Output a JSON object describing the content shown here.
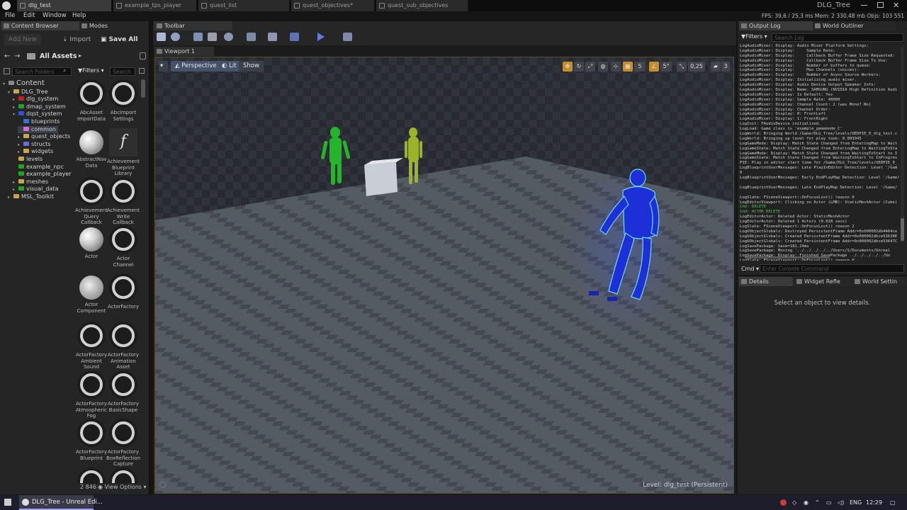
{
  "window": {
    "title": "DLG_Tree",
    "tabs": [
      {
        "label": "dlg_test",
        "active": true
      },
      {
        "label": "example_tps_player",
        "active": false
      },
      {
        "label": "quest_list",
        "active": false
      },
      {
        "label": "quest_objectives*",
        "active": false
      },
      {
        "label": "quest_sub_objectives",
        "active": false
      }
    ],
    "menu": [
      "File",
      "Edit",
      "Window",
      "Help"
    ],
    "stats": "FPS: 39,6 / 25,3 ms  Mem: 2 330,48 mb  Objs: 103 551"
  },
  "content_browser": {
    "tabs": [
      "Content Browser",
      "Modes"
    ],
    "add_new": "Add New",
    "import": "Import",
    "save_all": "Save All",
    "breadcrumb": "All Assets",
    "search_folders_placeholder": "Search Folders",
    "filters_label": "Filters",
    "search_assets_placeholder": "Search",
    "tree": [
      {
        "label": "Content",
        "depth": 0,
        "color": "#8a8a8a",
        "arrow": "▾"
      },
      {
        "label": "DLG_Tree",
        "depth": 1,
        "color": "#c9a64b",
        "arrow": "▾"
      },
      {
        "label": "dlg_system",
        "depth": 2,
        "color": "#c02020",
        "arrow": "▸"
      },
      {
        "label": "dmap_system",
        "depth": 2,
        "color": "#1fa32a",
        "arrow": "▸"
      },
      {
        "label": "dqst_system",
        "depth": 2,
        "color": "#3350d6",
        "arrow": "▾"
      },
      {
        "label": "blueprints",
        "depth": 3,
        "color": "#3a6fe0",
        "arrow": ""
      },
      {
        "label": "common",
        "depth": 3,
        "color": "#d66dd6",
        "arrow": "",
        "selected": true
      },
      {
        "label": "quest_objects",
        "depth": 3,
        "color": "#c9a64b",
        "arrow": "▸"
      },
      {
        "label": "structs",
        "depth": 3,
        "color": "#6a6de0",
        "arrow": "▸"
      },
      {
        "label": "widgets",
        "depth": 3,
        "color": "#c9a64b",
        "arrow": "▸"
      },
      {
        "label": "levels",
        "depth": 2,
        "color": "#c9a64b",
        "arrow": ""
      },
      {
        "label": "example_npc",
        "depth": 2,
        "color": "#1fa32a",
        "arrow": ""
      },
      {
        "label": "example_player",
        "depth": 2,
        "color": "#1fa32a",
        "arrow": ""
      },
      {
        "label": "meshes",
        "depth": 2,
        "color": "#c9a64b",
        "arrow": "▸"
      },
      {
        "label": "visual_data",
        "depth": 2,
        "color": "#1fa32a",
        "arrow": "▸"
      },
      {
        "label": "MSL_Toolkit",
        "depth": 1,
        "color": "#c9a64b",
        "arrow": "▸"
      }
    ],
    "assets": [
      {
        "label": "AbcAsset ImportData",
        "icon": "ring"
      },
      {
        "label": "AbcImport Settings",
        "icon": "ring"
      },
      {
        "label": "AbstractNav Data",
        "icon": "sphere"
      },
      {
        "label": "Achievement Blueprint Library",
        "icon": "func"
      },
      {
        "label": "Achievement Query Callback",
        "icon": "ring"
      },
      {
        "label": "Achievement Write Callback",
        "icon": "ring"
      },
      {
        "label": "Actor",
        "icon": "sphere"
      },
      {
        "label": "Actor Channel",
        "icon": "ring"
      },
      {
        "label": "Actor Component",
        "icon": "actorcomp"
      },
      {
        "label": "ActorFactory",
        "icon": "ring"
      },
      {
        "label": "ActorFactory Ambient Sound",
        "icon": "ring"
      },
      {
        "label": "ActorFactory Animation Asset",
        "icon": "ring"
      },
      {
        "label": "ActorFactory Atmospheric Fog",
        "icon": "ring"
      },
      {
        "label": "ActorFactory BasicShape",
        "icon": "ring"
      },
      {
        "label": "ActorFactory Blueprint",
        "icon": "ring"
      },
      {
        "label": "ActorFactory BoxReflection Capture",
        "icon": "ring"
      },
      {
        "label": "",
        "icon": "ring"
      },
      {
        "label": "",
        "icon": "ring"
      }
    ],
    "item_count": "2 846",
    "view_options": "View Options"
  },
  "toolbar": {
    "panel_title": "Toolbar"
  },
  "viewport": {
    "tab": "Viewport 1",
    "perspective": "Perspective",
    "lit": "Lit",
    "show": "Show",
    "grid_snap": "5",
    "rot_snap": "5°",
    "scale_snap": "0,25",
    "cam_speed": "3",
    "level_label": "Level:",
    "level_name": "dlg_test (Persistent)"
  },
  "output_log": {
    "tabs": [
      "Output Log",
      "World Outliner"
    ],
    "filters": "Filters",
    "search_placeholder": "Search Log",
    "lines": [
      {
        "t": "LogAudioMixer: Display: Audio Mixer Platform Settings:",
        "c": ""
      },
      {
        "t": "LogAudioMixer: Display:     Sample Rate:",
        "c": ""
      },
      {
        "t": "LogAudioMixer: Display:     Callback Buffer Frame Size Requested:",
        "c": ""
      },
      {
        "t": "LogAudioMixer: Display:     Callback Buffer Frame Size To Use:",
        "c": ""
      },
      {
        "t": "LogAudioMixer: Display:     Number of buffers to queue:",
        "c": ""
      },
      {
        "t": "LogAudioMixer: Display:     Max Channels (voices):",
        "c": ""
      },
      {
        "t": "LogAudioMixer: Display:     Number of Async Source Workers:",
        "c": ""
      },
      {
        "t": "LogAudioMixer: Display: Initializing audio mixer.",
        "c": ""
      },
      {
        "t": "LogAudioMixer: Display: Audio Device Output Speaker Info:",
        "c": ""
      },
      {
        "t": "LogAudioMixer: Display: Name: SAMSUNG (NVIDIA High Definition Audi",
        "c": ""
      },
      {
        "t": "LogAudioMixer: Display: Is Default: Yes",
        "c": ""
      },
      {
        "t": "LogAudioMixer: Display: Sample Rate: 48000",
        "c": ""
      },
      {
        "t": "LogAudioMixer: Display: Channel Count: 2 (was Mono? No)",
        "c": ""
      },
      {
        "t": "LogAudioMixer: Display: Channel Order:",
        "c": ""
      },
      {
        "t": "LogAudioMixer: Display: 0: FrontLeft",
        "c": ""
      },
      {
        "t": "LogAudioMixer: Display: 1: FrontRight",
        "c": ""
      },
      {
        "t": "LogInit: FAudioDevice initialized.",
        "c": ""
      },
      {
        "t": "LogLoad: Game class is 'example_gamemode_C'",
        "c": ""
      },
      {
        "t": "LogWorld: Bringing World /Game/DLG_Tree/levels/UEDPIE_0_dlg_test.c",
        "c": ""
      },
      {
        "t": "LogWorld: Bringing up level for play took: 0.003945",
        "c": ""
      },
      {
        "t": "LogGameMode: Display: Match State Changed from EnteringMap to Wait",
        "c": ""
      },
      {
        "t": "LogGameState: Match State Changed from EnteringMap to WaitingToSta",
        "c": ""
      },
      {
        "t": "LogGameMode: Display: Match State Changed from WaitingToStart to I",
        "c": ""
      },
      {
        "t": "LogGameState: Match State Changed from WaitingToStart to InProgres",
        "c": ""
      },
      {
        "t": "PIE: Play in editor start time for /Game/DLG_Tree/levels/UEDPIE_0_",
        "c": ""
      },
      {
        "t": "LogBlueprintUserMessages: Late PlayInEditor Detection: Level '/Gam",
        "c": ""
      },
      {
        "t": "0",
        "c": ""
      },
      {
        "t": "LogBlueprintUserMessages: Early EndPlayMap Detection: Level '/Game/",
        "c": ""
      },
      {
        "t": "",
        "c": ""
      },
      {
        "t": "LogBlueprintUserMessages: Late EndPlayMap Detection: Level '/Game/",
        "c": ""
      },
      {
        "t": "",
        "c": ""
      },
      {
        "t": "LogSlate: FSceneViewport::OnFocusLost() reason 0",
        "c": ""
      },
      {
        "t": "LogEditorViewport: Clicking on Actor (LMB): StaticMeshActor (Cube)",
        "c": ""
      },
      {
        "t": "Cmd: DELETE",
        "c": "g"
      },
      {
        "t": "Cmd: ACTOR DELETE",
        "c": "g"
      },
      {
        "t": "LogEditorActor: Deleted Actor: StaticMeshActor",
        "c": ""
      },
      {
        "t": "LogEditorActor: Deleted 1 Actors (0.028 secs)",
        "c": ""
      },
      {
        "t": "LogSlate: FSceneViewport::OnFocusLost() reason 2",
        "c": ""
      },
      {
        "t": "LogUObjectGlobals: Destroyed PersistentFrame Addr=0x000002db4464ce",
        "c": ""
      },
      {
        "t": "LogUObjectGlobals: Created PersistentFrame Addr=0x000002dbce53638E",
        "c": ""
      },
      {
        "t": "LogUObjectGlobals: Created PersistentFrame Addr=0x000002dbce53647C",
        "c": ""
      },
      {
        "t": "LogSavePackage: Save=181.24ms",
        "c": ""
      },
      {
        "t": "LogSavePackage: Moving '../../../../../Users/S/Documents/Unreal",
        "c": ""
      },
      {
        "t": "LogSavePackage: Display: Finished SavePackage ../../../../../Un",
        "c": ""
      },
      {
        "t": "LogSlate: FSceneViewport::OnFocusLost() reason 0",
        "c": ""
      }
    ],
    "cmd_label": "Cmd",
    "cmd_placeholder": "Enter Console Command"
  },
  "details": {
    "tabs": [
      "Details",
      "Widget Refle",
      "World Settin"
    ],
    "empty_message": "Select an object to view details."
  },
  "taskbar": {
    "app": "DLG_Tree - Unreal Edi...",
    "lang": "ENG",
    "time": "12:29"
  }
}
